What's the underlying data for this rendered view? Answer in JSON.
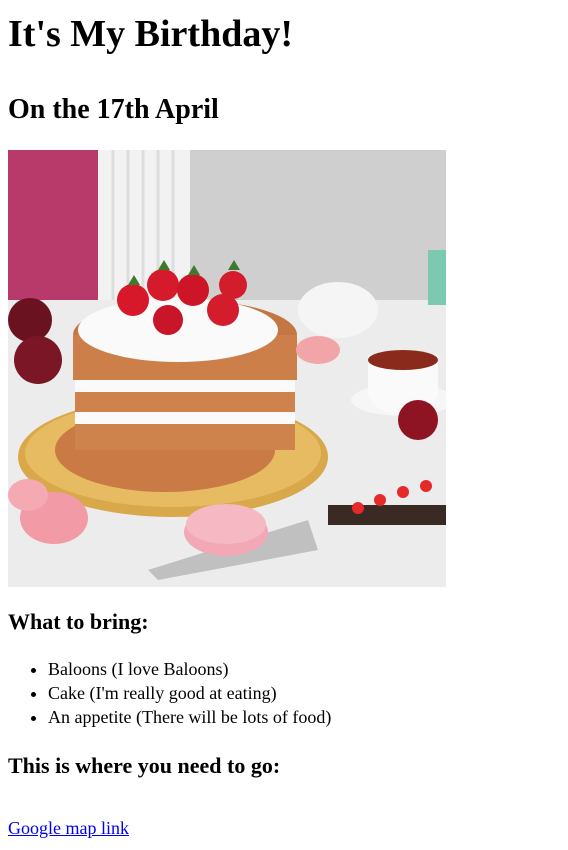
{
  "header": {
    "title": "It's My Birthday!",
    "date": "On the 17th April"
  },
  "image": {
    "alt": "Layered sponge cake with strawberries"
  },
  "bring": {
    "heading": "What to bring:",
    "items": [
      "Baloons (I love Baloons)",
      "Cake (I'm really good at eating)",
      "An appetite (There will be lots of food)"
    ]
  },
  "directions": {
    "heading": "This is where you need to go:",
    "link_label": "Google map link"
  },
  "colors": {
    "link": "#0000ee",
    "text": "#000000"
  }
}
